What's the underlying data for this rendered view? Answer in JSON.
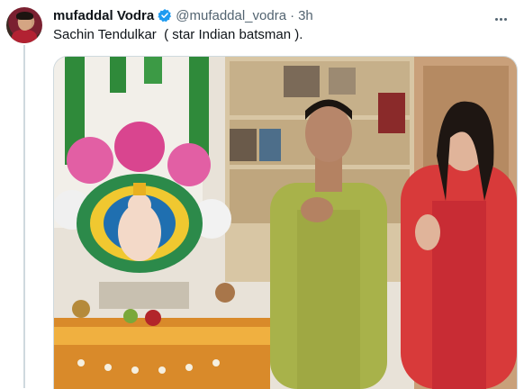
{
  "tweet": {
    "author_name": "mufaddal Vodra",
    "handle": "@mufaddal_vodra",
    "separator": "·",
    "time": "3h",
    "text": "Sachin Tendulkar  ( star Indian batsman )."
  },
  "icons": {
    "verified": "verified-badge-icon",
    "more": "more-options-icon"
  },
  "colors": {
    "verified_blue": "#1d9bf0",
    "text_primary": "#0f1419",
    "text_secondary": "#536471"
  }
}
